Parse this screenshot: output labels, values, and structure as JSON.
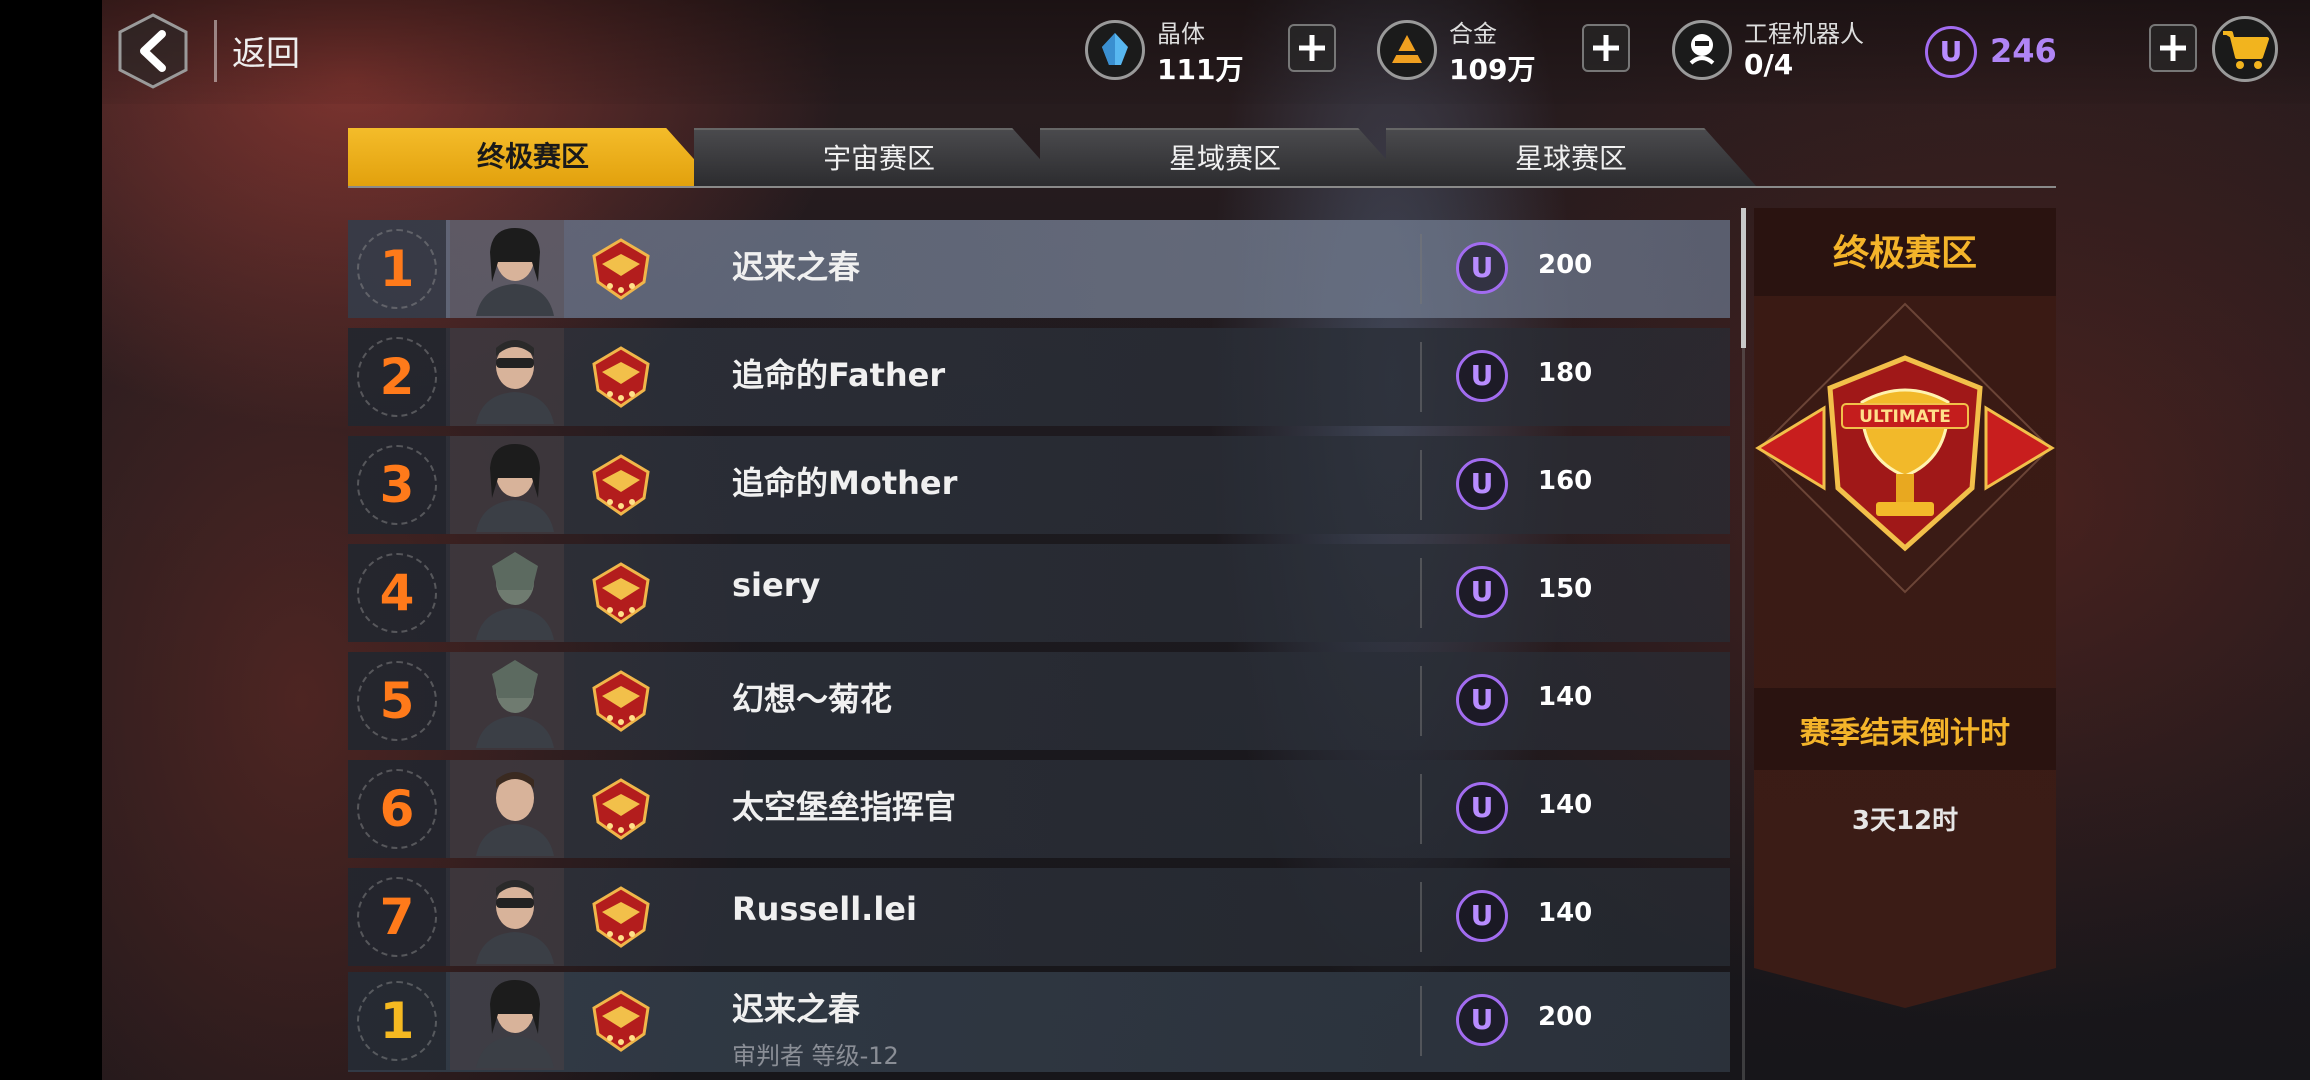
{
  "header": {
    "back_label": "返回",
    "resources": [
      {
        "icon": "crystal-icon",
        "label": "晶体",
        "value": "111万",
        "color": "#58b7f0"
      },
      {
        "icon": "alloy-icon",
        "label": "合金",
        "value": "109万",
        "color": "#f0a020"
      },
      {
        "icon": "robot-icon",
        "label": "工程机器人",
        "value": "0/4",
        "color": "#ffffff"
      }
    ],
    "u_icon": "U",
    "u_balance": "246"
  },
  "tabs": [
    {
      "label": "终极赛区",
      "active": true
    },
    {
      "label": "宇宙赛区",
      "active": false
    },
    {
      "label": "星域赛区",
      "active": false
    },
    {
      "label": "星球赛区",
      "active": false
    }
  ],
  "leaderboard": [
    {
      "rank": "1",
      "name": "迟来之春",
      "score": "200",
      "avatar": "female-pilot-avatar"
    },
    {
      "rank": "2",
      "name": "追命的Father",
      "score": "180",
      "avatar": "goggles-soldier-avatar"
    },
    {
      "rank": "3",
      "name": "追命的Mother",
      "score": "160",
      "avatar": "female-pilot-avatar"
    },
    {
      "rank": "4",
      "name": "siery",
      "score": "150",
      "avatar": "alien-warrior-avatar"
    },
    {
      "rank": "5",
      "name": "幻想～菊花",
      "score": "140",
      "avatar": "alien-warrior-avatar"
    },
    {
      "rank": "6",
      "name": "太空堡垒指挥官",
      "score": "140",
      "avatar": "commander-avatar"
    },
    {
      "rank": "7",
      "name": "Russell.lei",
      "score": "140",
      "avatar": "goggles-soldier-avatar"
    }
  ],
  "my_rank": {
    "rank": "1",
    "name": "迟来之春",
    "subtitle": "审判者 等级-12",
    "score": "200",
    "avatar": "female-pilot-avatar"
  },
  "side_panel": {
    "title": "终极赛区",
    "trophy_text": "ULTIMATE",
    "countdown_label": "赛季结束倒计时",
    "countdown_value": "3天12时"
  },
  "colors": {
    "accent_gold": "#f4b42a",
    "rank_orange": "#ff7a1a",
    "u_purple": "#a26cf0"
  }
}
